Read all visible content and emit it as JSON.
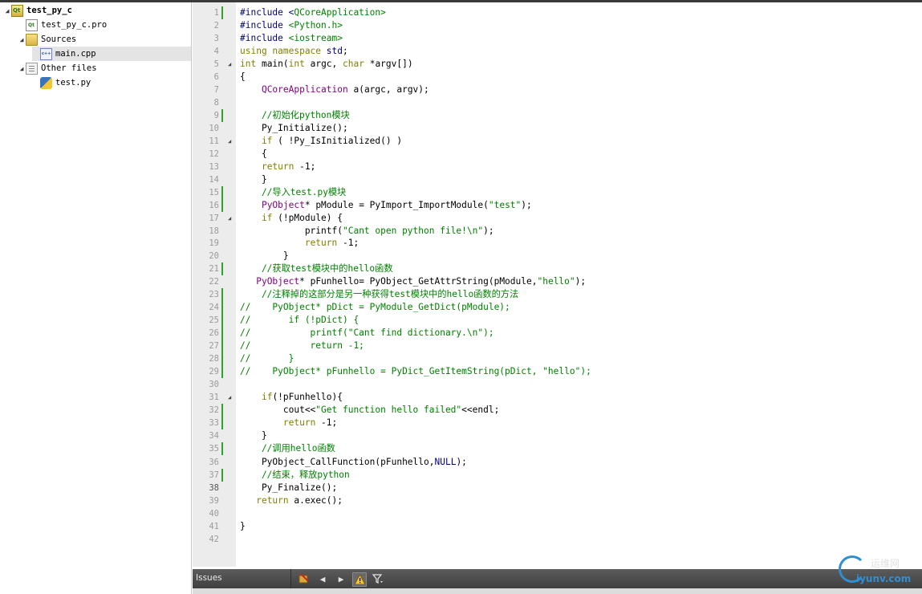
{
  "tree": {
    "project": "test_py_c",
    "pro_file": "test_py_c.pro",
    "sources": "Sources",
    "main_cpp": "main.cpp",
    "other_files": "Other files",
    "test_py": "test.py"
  },
  "editor": {
    "current_line": 38,
    "changed_lines": [
      1,
      9,
      15,
      16,
      21,
      23,
      24,
      25,
      26,
      27,
      28,
      29,
      32,
      33,
      35,
      37
    ],
    "fold_lines": [
      5,
      11,
      17,
      31
    ],
    "lines": [
      [
        [
          "#include <",
          "p"
        ],
        [
          "QCoreApplication",
          "s"
        ],
        [
          ">",
          "s"
        ]
      ],
      [
        [
          "#include ",
          "p"
        ],
        [
          "<Python.h>",
          "s"
        ]
      ],
      [
        [
          "#include ",
          "p"
        ],
        [
          "<iostream>",
          "s"
        ]
      ],
      [
        [
          "using namespace ",
          "k"
        ],
        [
          "std",
          "n"
        ],
        [
          ";",
          ""
        ]
      ],
      [
        [
          "int ",
          "k"
        ],
        [
          "main(",
          ""
        ],
        [
          "int ",
          "k"
        ],
        [
          "argc, ",
          ""
        ],
        [
          "char ",
          "k"
        ],
        [
          "*argv[])",
          ""
        ]
      ],
      [
        [
          "{",
          ""
        ]
      ],
      [
        [
          "    ",
          ""
        ],
        [
          "QCoreApplication",
          "t"
        ],
        [
          " a(argc, argv);",
          ""
        ]
      ],
      [
        [
          "",
          ""
        ]
      ],
      [
        [
          "    //初始化python模块",
          "c"
        ]
      ],
      [
        [
          "    Py_Initialize();",
          ""
        ]
      ],
      [
        [
          "    ",
          ""
        ],
        [
          "if",
          "k"
        ],
        [
          " ( !Py_IsInitialized() )",
          ""
        ]
      ],
      [
        [
          "    {",
          ""
        ]
      ],
      [
        [
          "    ",
          ""
        ],
        [
          "return",
          "k"
        ],
        [
          " -1;",
          ""
        ]
      ],
      [
        [
          "    }",
          ""
        ]
      ],
      [
        [
          "    //导入test.py模块",
          "c"
        ]
      ],
      [
        [
          "    ",
          ""
        ],
        [
          "PyObject",
          "t"
        ],
        [
          "* pModule = PyImport_ImportModule(",
          ""
        ],
        [
          "\"test\"",
          "s"
        ],
        [
          ");",
          ""
        ]
      ],
      [
        [
          "    ",
          ""
        ],
        [
          "if",
          "k"
        ],
        [
          " (!pModule) {",
          ""
        ]
      ],
      [
        [
          "            printf(",
          ""
        ],
        [
          "\"Cant open python file!\\n\"",
          "s"
        ],
        [
          ");",
          ""
        ]
      ],
      [
        [
          "            ",
          ""
        ],
        [
          "return",
          "k"
        ],
        [
          " -1;",
          ""
        ]
      ],
      [
        [
          "        }",
          ""
        ]
      ],
      [
        [
          "    //获取test模块中的hello函数",
          "c"
        ]
      ],
      [
        [
          "   ",
          ""
        ],
        [
          "PyObject",
          "t"
        ],
        [
          "* pFunhello= PyObject_GetAttrString(pModule,",
          ""
        ],
        [
          "\"hello\"",
          "s"
        ],
        [
          ");",
          ""
        ]
      ],
      [
        [
          "    //注释掉的这部分是另一种获得test模块中的hello函数的方法",
          "c"
        ]
      ],
      [
        [
          "//    PyObject* pDict = PyModule_GetDict(pModule);",
          "c"
        ]
      ],
      [
        [
          "//       if (!pDict) {",
          "c"
        ]
      ],
      [
        [
          "//           printf(\"Cant find dictionary.\\n\");",
          "c"
        ]
      ],
      [
        [
          "//           return -1;",
          "c"
        ]
      ],
      [
        [
          "//       }",
          "c"
        ]
      ],
      [
        [
          "//    PyObject* pFunhello = PyDict_GetItemString(pDict, \"hello\");",
          "c"
        ]
      ],
      [
        [
          "",
          ""
        ]
      ],
      [
        [
          "    ",
          ""
        ],
        [
          "if",
          "k"
        ],
        [
          "(!pFunhello){",
          ""
        ]
      ],
      [
        [
          "        cout<<",
          ""
        ],
        [
          "\"Get function hello failed\"",
          "s"
        ],
        [
          "<<endl;",
          ""
        ]
      ],
      [
        [
          "        ",
          ""
        ],
        [
          "return",
          "k"
        ],
        [
          " -1;",
          ""
        ]
      ],
      [
        [
          "    }",
          ""
        ]
      ],
      [
        [
          "    //调用hello函数",
          "c"
        ]
      ],
      [
        [
          "    PyObject_CallFunction(pFunhello,",
          ""
        ],
        [
          "NULL",
          "n"
        ],
        [
          ");",
          ""
        ]
      ],
      [
        [
          "    //结束，释放python",
          "c"
        ]
      ],
      [
        [
          "    Py_Finalize();",
          ""
        ]
      ],
      [
        [
          "   ",
          ""
        ],
        [
          "return",
          "k"
        ],
        [
          " a.exec();",
          ""
        ]
      ],
      [
        [
          "",
          ""
        ]
      ],
      [
        [
          "}",
          ""
        ]
      ],
      [
        [
          "",
          ""
        ]
      ]
    ]
  },
  "issues": {
    "label": "Issues"
  },
  "watermark": {
    "cn": "运维网",
    "en": "iyunv.com"
  }
}
